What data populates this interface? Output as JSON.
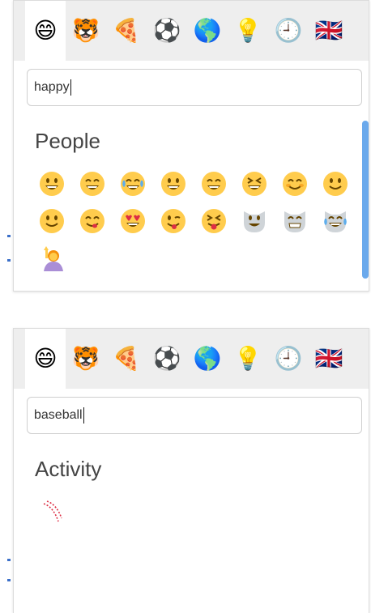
{
  "pickers": [
    {
      "search_value": "happy",
      "category": "People",
      "tabs": [
        {
          "name": "smileys",
          "glyph": "😄"
        },
        {
          "name": "animals",
          "glyph": "🐯"
        },
        {
          "name": "food",
          "glyph": "🍕"
        },
        {
          "name": "activity",
          "glyph": "⚽"
        },
        {
          "name": "travel",
          "glyph": "🌎"
        },
        {
          "name": "objects",
          "glyph": "💡"
        },
        {
          "name": "recent",
          "glyph": "🕘"
        },
        {
          "name": "flags",
          "glyph": "🇬🇧"
        }
      ]
    },
    {
      "search_value": "baseball",
      "category": "Activity",
      "tabs": [
        {
          "name": "smileys",
          "glyph": "😄"
        },
        {
          "name": "animals",
          "glyph": "🐯"
        },
        {
          "name": "food",
          "glyph": "🍕"
        },
        {
          "name": "activity",
          "glyph": "⚽"
        },
        {
          "name": "travel",
          "glyph": "🌎"
        },
        {
          "name": "objects",
          "glyph": "💡"
        },
        {
          "name": "recent",
          "glyph": "🕘"
        },
        {
          "name": "flags",
          "glyph": "🇬🇧"
        }
      ]
    }
  ],
  "results_1": [
    {
      "name": "grinning-face",
      "kind": "grin"
    },
    {
      "name": "grinning-smiling-eyes",
      "kind": "beam"
    },
    {
      "name": "joy",
      "kind": "joy"
    },
    {
      "name": "smiley",
      "kind": "grin"
    },
    {
      "name": "smile",
      "kind": "beam"
    },
    {
      "name": "laughing",
      "kind": "squint"
    },
    {
      "name": "blush",
      "kind": "blush"
    },
    {
      "name": "slightly-smiling",
      "kind": "slight"
    },
    {
      "name": "relaxed",
      "kind": "slight"
    },
    {
      "name": "yum",
      "kind": "yum"
    },
    {
      "name": "heart-eyes",
      "kind": "hearts"
    },
    {
      "name": "stuck-out-tongue-winking",
      "kind": "wink"
    },
    {
      "name": "stuck-out-tongue-closed",
      "kind": "tongue"
    },
    {
      "name": "smiley-cat",
      "kind": "cat"
    },
    {
      "name": "smile-cat",
      "kind": "catgrin"
    },
    {
      "name": "joy-cat",
      "kind": "catjoy"
    },
    {
      "name": "raising-hand",
      "kind": "person"
    }
  ],
  "results_2": [
    {
      "name": "baseball",
      "kind": "baseball"
    }
  ],
  "colors": {
    "face": "#ffcc4d",
    "mouth": "#664500",
    "tear": "#5dadec",
    "heart": "#dd2e44",
    "cat": "#cfd4d8",
    "scrollbar": "#6aa9ec"
  }
}
